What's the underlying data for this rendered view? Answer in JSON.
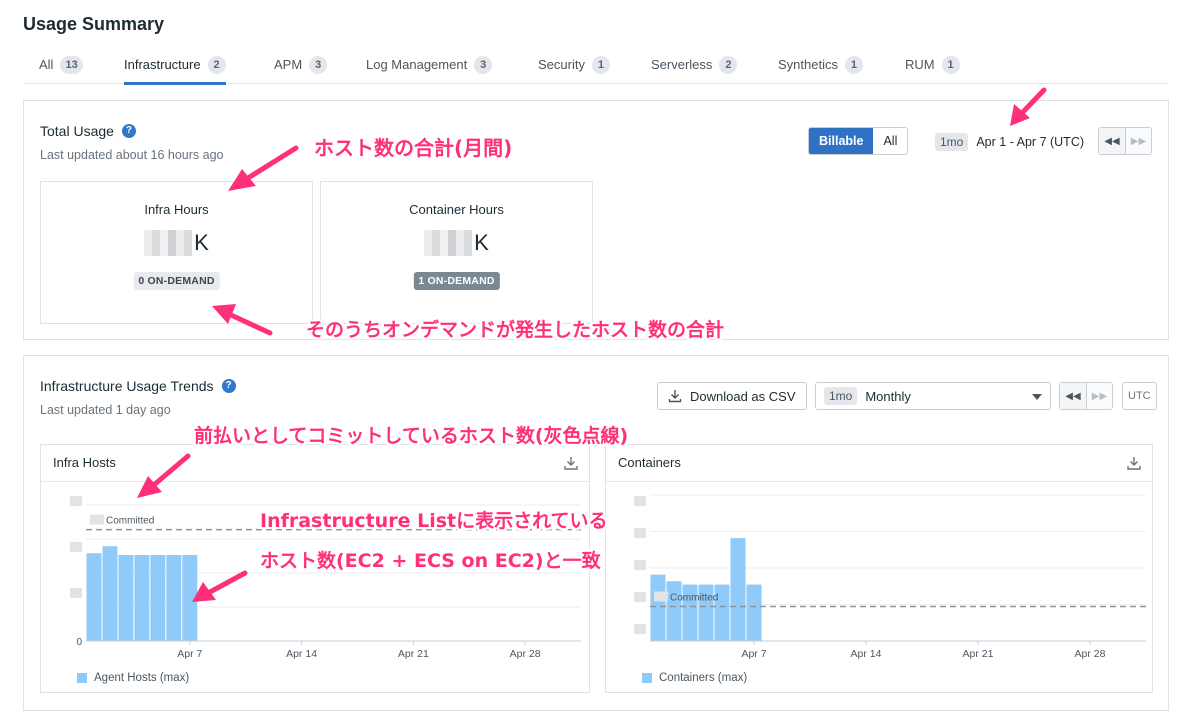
{
  "page": {
    "title": "Usage Summary"
  },
  "tabs": [
    {
      "label": "All",
      "count": "13"
    },
    {
      "label": "Infrastructure",
      "count": "2"
    },
    {
      "label": "APM",
      "count": "3"
    },
    {
      "label": "Log Management",
      "count": "3"
    },
    {
      "label": "Security",
      "count": "1"
    },
    {
      "label": "Serverless",
      "count": "2"
    },
    {
      "label": "Synthetics",
      "count": "1"
    },
    {
      "label": "RUM",
      "count": "1"
    }
  ],
  "total_usage": {
    "title": "Total Usage",
    "help_icon": "?",
    "updated": "Last updated about 16 hours ago",
    "toggle": {
      "billable": "Billable",
      "all": "All"
    },
    "period_pill": "1mo",
    "range": "Apr 1 - Apr 7 (UTC)",
    "nav": {
      "prev": "◀◀",
      "next": "▶▶"
    },
    "cards": [
      {
        "label": "Infra Hours",
        "value_suffix": "K",
        "badge": "0 ON-DEMAND"
      },
      {
        "label": "Container Hours",
        "value_suffix": "K",
        "badge": "1 ON-DEMAND"
      }
    ]
  },
  "trends": {
    "title": "Infrastructure Usage Trends",
    "help_icon": "?",
    "updated": "Last updated 1 day ago",
    "download_label": "Download as CSV",
    "period_pill": "1mo",
    "interval": "Monthly",
    "nav": {
      "prev": "◀◀",
      "next": "▶▶"
    },
    "utc": "UTC",
    "charts": [
      {
        "title": "Infra Hosts",
        "legend": "Agent Hosts (max)",
        "committed_label": "Committed",
        "zero": "0"
      },
      {
        "title": "Containers",
        "legend": "Containers (max)",
        "committed_label": "Committed"
      }
    ]
  },
  "chart_data": [
    {
      "type": "bar",
      "title": "Infra Hosts",
      "x_ticks": [
        "Apr 7",
        "Apr 14",
        "Apr 21",
        "Apr 28"
      ],
      "y_ticks": [
        "0"
      ],
      "series": [
        {
          "name": "Agent Hosts (max)",
          "values": [
            1.0,
            1.08,
            0.98,
            0.98,
            0.98,
            0.98,
            0.98
          ]
        }
      ],
      "committed": 1.27,
      "ylim": [
        0,
        1.55
      ],
      "color": "#90caf9"
    },
    {
      "type": "bar",
      "title": "Containers",
      "x_ticks": [
        "Apr 7",
        "Apr 14",
        "Apr 21",
        "Apr 28"
      ],
      "series": [
        {
          "name": "Containers (max)",
          "values": [
            1.0,
            0.9,
            0.85,
            0.85,
            0.85,
            1.55,
            0.85
          ]
        }
      ],
      "committed": 0.52,
      "ylim": [
        0,
        2.2
      ],
      "color": "#90caf9"
    }
  ],
  "annotations": {
    "a1": "ホスト数の合計(月間)",
    "a2": "そのうちオンデマンドが発生したホスト数の合計",
    "a3": "前払いとしてコミットしているホスト数(灰色点線)",
    "a4": "Infrastructure Listに表示されている",
    "a5": "ホスト数(EC2 + ECS on EC2)と一致"
  },
  "colors": {
    "accent": "#3277c8",
    "annotation": "#ff2f7a",
    "bar": "#90caf9"
  }
}
